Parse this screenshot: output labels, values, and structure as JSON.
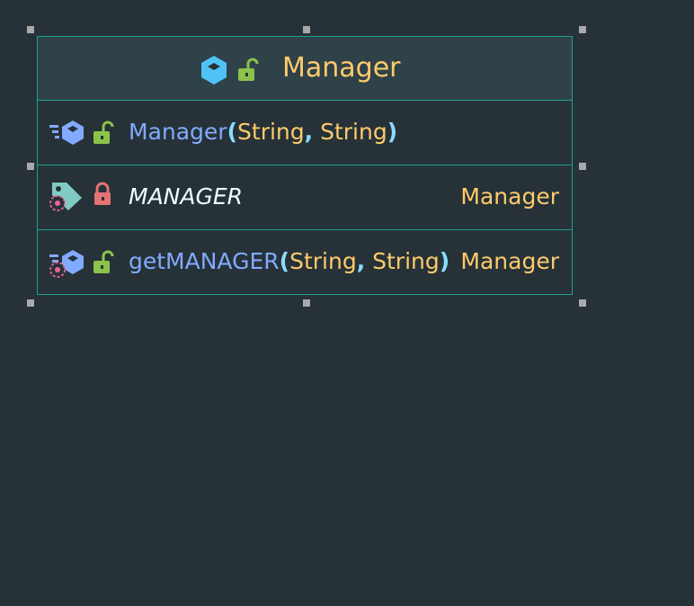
{
  "diagram": {
    "class": {
      "name": "Manager",
      "icons": [
        "class-icon",
        "public-lock-open-icon"
      ]
    },
    "members": [
      {
        "kind": "constructor",
        "icons": [
          "method-icon",
          "public-lock-open-icon"
        ],
        "name": "Manager",
        "open_paren": "(",
        "params": [
          "String",
          "String"
        ],
        "comma": ",",
        "close_paren": ")",
        "return_type": ""
      },
      {
        "kind": "field",
        "icons": [
          "field-tag-icon",
          "static-target-icon",
          "private-lock-closed-icon"
        ],
        "name": "MANAGER",
        "return_type": "Manager"
      },
      {
        "kind": "method",
        "icons": [
          "method-icon",
          "static-target-icon",
          "public-lock-open-icon"
        ],
        "name": "getMANAGER",
        "open_paren": "(",
        "params": [
          "String",
          "String"
        ],
        "comma": ",",
        "close_paren": ")",
        "return_type": "Manager"
      }
    ],
    "colors": {
      "background": "#263238",
      "header_background": "#2f4149",
      "border": "#1e9f8c",
      "class_name": "#ffcb6b",
      "method_name": "#82aaff",
      "field_name": "#eeffff",
      "type": "#ffcb6b",
      "punctuation": "#89ddff",
      "class_icon": "#4fc3f7",
      "public_lock": "#8bc34a",
      "private_lock": "#e57373",
      "field_tag": "#80cbc4",
      "method_icon": "#82aaff",
      "static_marker": "#f06292",
      "selection_handle": "#a9a9a9"
    }
  }
}
